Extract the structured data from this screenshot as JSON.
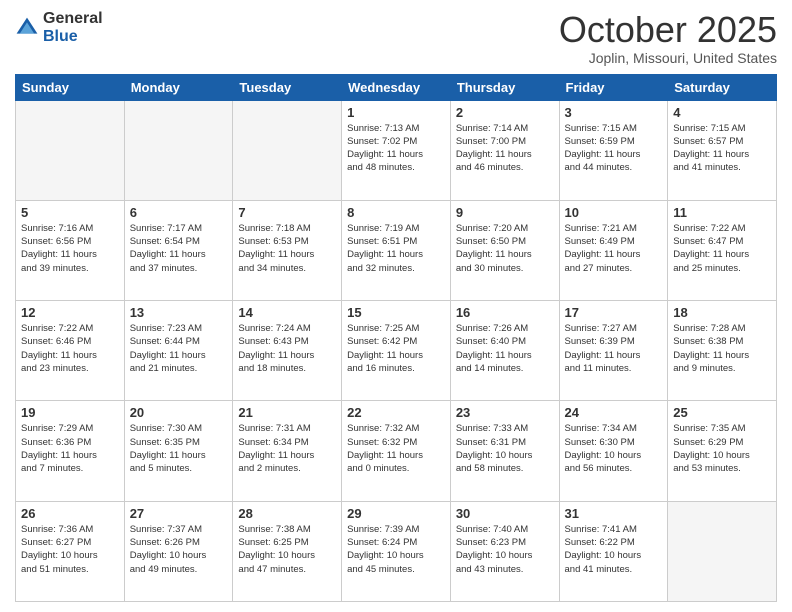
{
  "logo": {
    "general": "General",
    "blue": "Blue"
  },
  "header": {
    "month": "October 2025",
    "location": "Joplin, Missouri, United States"
  },
  "days_of_week": [
    "Sunday",
    "Monday",
    "Tuesday",
    "Wednesday",
    "Thursday",
    "Friday",
    "Saturday"
  ],
  "weeks": [
    [
      {
        "day": "",
        "info": ""
      },
      {
        "day": "",
        "info": ""
      },
      {
        "day": "",
        "info": ""
      },
      {
        "day": "1",
        "info": "Sunrise: 7:13 AM\nSunset: 7:02 PM\nDaylight: 11 hours\nand 48 minutes."
      },
      {
        "day": "2",
        "info": "Sunrise: 7:14 AM\nSunset: 7:00 PM\nDaylight: 11 hours\nand 46 minutes."
      },
      {
        "day": "3",
        "info": "Sunrise: 7:15 AM\nSunset: 6:59 PM\nDaylight: 11 hours\nand 44 minutes."
      },
      {
        "day": "4",
        "info": "Sunrise: 7:15 AM\nSunset: 6:57 PM\nDaylight: 11 hours\nand 41 minutes."
      }
    ],
    [
      {
        "day": "5",
        "info": "Sunrise: 7:16 AM\nSunset: 6:56 PM\nDaylight: 11 hours\nand 39 minutes."
      },
      {
        "day": "6",
        "info": "Sunrise: 7:17 AM\nSunset: 6:54 PM\nDaylight: 11 hours\nand 37 minutes."
      },
      {
        "day": "7",
        "info": "Sunrise: 7:18 AM\nSunset: 6:53 PM\nDaylight: 11 hours\nand 34 minutes."
      },
      {
        "day": "8",
        "info": "Sunrise: 7:19 AM\nSunset: 6:51 PM\nDaylight: 11 hours\nand 32 minutes."
      },
      {
        "day": "9",
        "info": "Sunrise: 7:20 AM\nSunset: 6:50 PM\nDaylight: 11 hours\nand 30 minutes."
      },
      {
        "day": "10",
        "info": "Sunrise: 7:21 AM\nSunset: 6:49 PM\nDaylight: 11 hours\nand 27 minutes."
      },
      {
        "day": "11",
        "info": "Sunrise: 7:22 AM\nSunset: 6:47 PM\nDaylight: 11 hours\nand 25 minutes."
      }
    ],
    [
      {
        "day": "12",
        "info": "Sunrise: 7:22 AM\nSunset: 6:46 PM\nDaylight: 11 hours\nand 23 minutes."
      },
      {
        "day": "13",
        "info": "Sunrise: 7:23 AM\nSunset: 6:44 PM\nDaylight: 11 hours\nand 21 minutes."
      },
      {
        "day": "14",
        "info": "Sunrise: 7:24 AM\nSunset: 6:43 PM\nDaylight: 11 hours\nand 18 minutes."
      },
      {
        "day": "15",
        "info": "Sunrise: 7:25 AM\nSunset: 6:42 PM\nDaylight: 11 hours\nand 16 minutes."
      },
      {
        "day": "16",
        "info": "Sunrise: 7:26 AM\nSunset: 6:40 PM\nDaylight: 11 hours\nand 14 minutes."
      },
      {
        "day": "17",
        "info": "Sunrise: 7:27 AM\nSunset: 6:39 PM\nDaylight: 11 hours\nand 11 minutes."
      },
      {
        "day": "18",
        "info": "Sunrise: 7:28 AM\nSunset: 6:38 PM\nDaylight: 11 hours\nand 9 minutes."
      }
    ],
    [
      {
        "day": "19",
        "info": "Sunrise: 7:29 AM\nSunset: 6:36 PM\nDaylight: 11 hours\nand 7 minutes."
      },
      {
        "day": "20",
        "info": "Sunrise: 7:30 AM\nSunset: 6:35 PM\nDaylight: 11 hours\nand 5 minutes."
      },
      {
        "day": "21",
        "info": "Sunrise: 7:31 AM\nSunset: 6:34 PM\nDaylight: 11 hours\nand 2 minutes."
      },
      {
        "day": "22",
        "info": "Sunrise: 7:32 AM\nSunset: 6:32 PM\nDaylight: 11 hours\nand 0 minutes."
      },
      {
        "day": "23",
        "info": "Sunrise: 7:33 AM\nSunset: 6:31 PM\nDaylight: 10 hours\nand 58 minutes."
      },
      {
        "day": "24",
        "info": "Sunrise: 7:34 AM\nSunset: 6:30 PM\nDaylight: 10 hours\nand 56 minutes."
      },
      {
        "day": "25",
        "info": "Sunrise: 7:35 AM\nSunset: 6:29 PM\nDaylight: 10 hours\nand 53 minutes."
      }
    ],
    [
      {
        "day": "26",
        "info": "Sunrise: 7:36 AM\nSunset: 6:27 PM\nDaylight: 10 hours\nand 51 minutes."
      },
      {
        "day": "27",
        "info": "Sunrise: 7:37 AM\nSunset: 6:26 PM\nDaylight: 10 hours\nand 49 minutes."
      },
      {
        "day": "28",
        "info": "Sunrise: 7:38 AM\nSunset: 6:25 PM\nDaylight: 10 hours\nand 47 minutes."
      },
      {
        "day": "29",
        "info": "Sunrise: 7:39 AM\nSunset: 6:24 PM\nDaylight: 10 hours\nand 45 minutes."
      },
      {
        "day": "30",
        "info": "Sunrise: 7:40 AM\nSunset: 6:23 PM\nDaylight: 10 hours\nand 43 minutes."
      },
      {
        "day": "31",
        "info": "Sunrise: 7:41 AM\nSunset: 6:22 PM\nDaylight: 10 hours\nand 41 minutes."
      },
      {
        "day": "",
        "info": ""
      }
    ]
  ]
}
